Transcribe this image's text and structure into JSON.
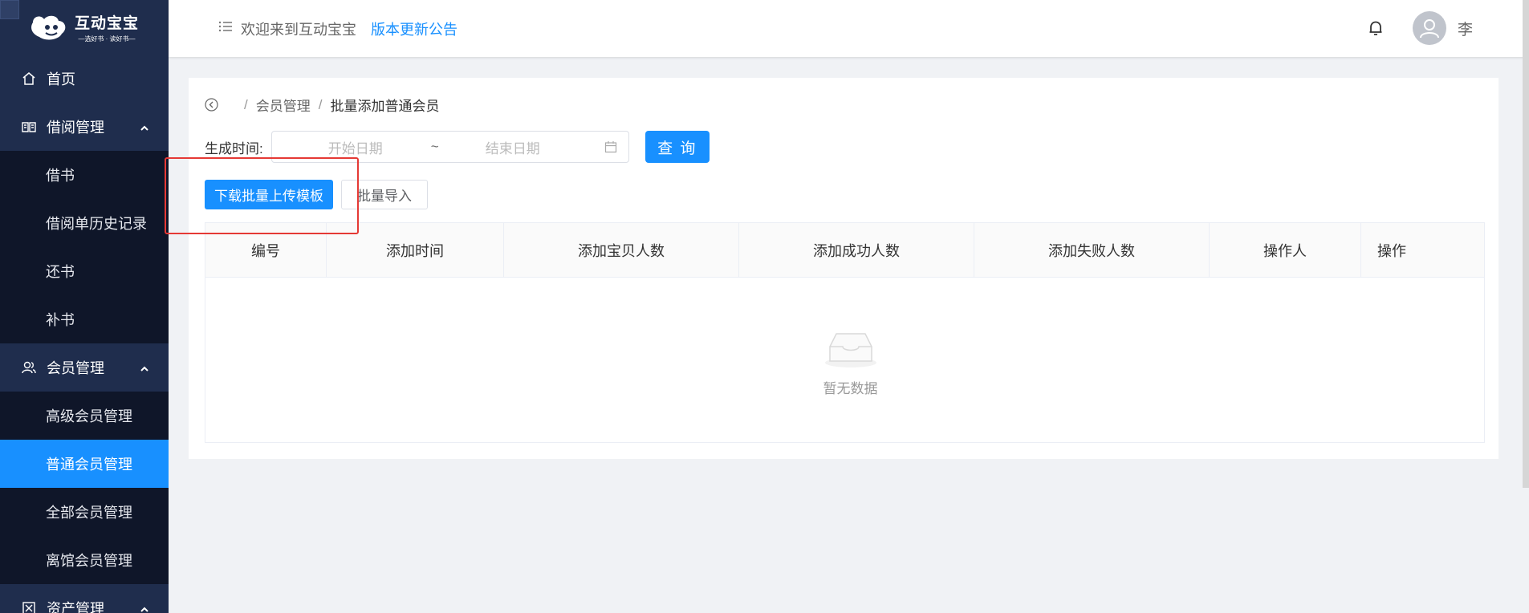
{
  "app": {
    "logo_title": "互动宝宝",
    "logo_subtitle": "—选好书 · 读好书—"
  },
  "sidebar": {
    "items": [
      {
        "label": "首页",
        "icon": "home-icon"
      },
      {
        "label": "借阅管理",
        "icon": "book-icon",
        "expanded": true,
        "children": [
          "借书",
          "借阅单历史记录",
          "还书",
          "补书"
        ]
      },
      {
        "label": "会员管理",
        "icon": "users-icon",
        "expanded": true,
        "children": [
          "高级会员管理",
          "普通会员管理",
          "全部会员管理",
          "离馆会员管理"
        ],
        "active_child": "普通会员管理"
      },
      {
        "label": "资产管理",
        "icon": "asset-icon"
      }
    ]
  },
  "header": {
    "welcome": "欢迎来到互动宝宝",
    "update_link": "版本更新公告",
    "username": "李"
  },
  "breadcrumb": {
    "sep": "/",
    "items": [
      "会员管理",
      "批量添加普通会员"
    ]
  },
  "filter": {
    "label": "生成时间:",
    "start_placeholder": "开始日期",
    "range_separator": "~",
    "end_placeholder": "结束日期",
    "query_button": "查 询"
  },
  "actions": {
    "download_template": "下载批量上传模板",
    "batch_import": "批量导入"
  },
  "table": {
    "columns": [
      "编号",
      "添加时间",
      "添加宝贝人数",
      "添加成功人数",
      "添加失败人数",
      "操作人",
      "操作"
    ],
    "rows": [],
    "empty_text": "暂无数据"
  },
  "colors": {
    "sidebar_bg": "#1f2d4d",
    "submenu_bg": "#0f1629",
    "primary": "#1890ff",
    "highlight": "#e53935"
  }
}
